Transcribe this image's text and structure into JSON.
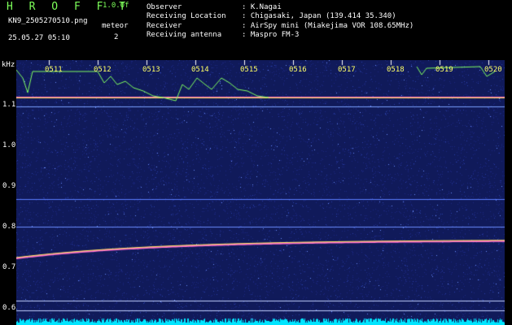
{
  "header": {
    "brand": "H R O F F T",
    "version": "1.0.0f",
    "filename": "KN9_2505270510.png",
    "timestamp": "25.05.27 05:10",
    "meteor_label": "meteor",
    "meteor_count": "2",
    "info": [
      {
        "label": "Observer",
        "value": ": K.Nagai"
      },
      {
        "label": "Receiving Location",
        "value": ": Chigasaki, Japan (139.414 35.340)"
      },
      {
        "label": "Receiver",
        "value": ": AirSpy mini (Miakejima VOR 108.65MHz)"
      },
      {
        "label": "Receiving antenna",
        "value": ": Maspro FM-3"
      }
    ]
  },
  "axis": {
    "unit": "kHz",
    "ticks": [
      "1.1",
      "1.0",
      "0.9",
      "0.8",
      "0.7",
      "0.6"
    ]
  },
  "time_labels": [
    "0511",
    "0512",
    "0513",
    "0514",
    "0515",
    "0516",
    "0517",
    "0518",
    "0519",
    "0520"
  ],
  "colors": {
    "background": "#000000",
    "spectrum_bg": "#101a5a",
    "header_green": "#7dff5a",
    "time_label": "#ffff66",
    "trace": "#80ff60",
    "baseline": "#00e5ff"
  }
}
